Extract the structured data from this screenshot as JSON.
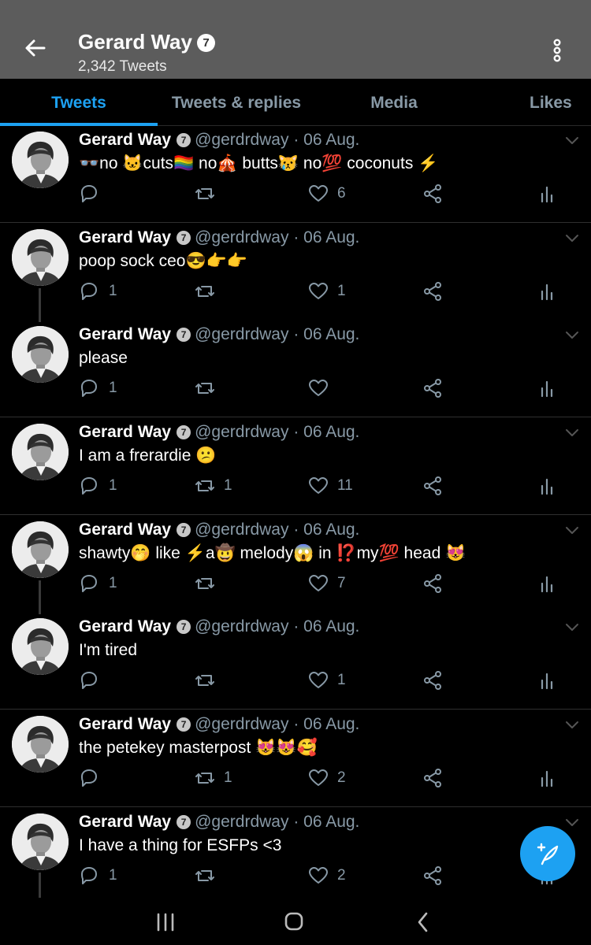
{
  "header": {
    "title": "Gerard Way",
    "verified_glyph": "7",
    "tweet_count": "2,342 Tweets",
    "back_icon": "arrow-left-icon",
    "more_icon": "more-vertical-icon"
  },
  "tabs": [
    {
      "label": "Tweets",
      "active": true
    },
    {
      "label": "Tweets & replies",
      "active": false
    },
    {
      "label": "Media",
      "active": false
    },
    {
      "label": "Likes",
      "active": false
    }
  ],
  "colors": {
    "accent": "#1da1f2",
    "header_bg": "#5c5c5c",
    "muted": "#8899a6",
    "background": "#000000"
  },
  "tweets": [
    {
      "name": "Gerard Way",
      "badge": "7",
      "handle": "@gerdrdway",
      "date": "· 06 Aug.",
      "segments": [
        "👓",
        "no ",
        "🐱",
        "cuts",
        "🏳️‍🌈",
        " no",
        "🎪",
        " butts",
        "😿",
        " no",
        "💯",
        " coconuts ",
        "⚡"
      ],
      "replies": "",
      "retweets": "",
      "likes": "6"
    },
    {
      "name": "Gerard Way",
      "badge": "7",
      "handle": "@gerdrdway",
      "date": "· 06 Aug.",
      "segments": [
        "poop sock ceo",
        "😎",
        "👉",
        "👉"
      ],
      "replies": "1",
      "retweets": "",
      "likes": "1"
    },
    {
      "name": "Gerard Way",
      "badge": "7",
      "handle": "@gerdrdway",
      "date": "· 06 Aug.",
      "segments": [
        "please"
      ],
      "replies": "1",
      "retweets": "",
      "likes": ""
    },
    {
      "name": "Gerard Way",
      "badge": "7",
      "handle": "@gerdrdway",
      "date": "· 06 Aug.",
      "segments": [
        "I am a frerardie ",
        "😕"
      ],
      "replies": "1",
      "retweets": "1",
      "likes": "11"
    },
    {
      "name": "Gerard Way",
      "badge": "7",
      "handle": "@gerdrdway",
      "date": "· 06 Aug.",
      "segments": [
        "shawty",
        "🤭",
        " like ",
        "⚡",
        "a",
        "🤠",
        " melody",
        "😱",
        " in ",
        "⁉️",
        "my",
        "💯",
        " head ",
        "😻"
      ],
      "replies": "1",
      "retweets": "",
      "likes": "7"
    },
    {
      "name": "Gerard Way",
      "badge": "7",
      "handle": "@gerdrdway",
      "date": "· 06 Aug.",
      "segments": [
        "I'm tired"
      ],
      "replies": "",
      "retweets": "",
      "likes": "1"
    },
    {
      "name": "Gerard Way",
      "badge": "7",
      "handle": "@gerdrdway",
      "date": "· 06 Aug.",
      "segments": [
        "the petekey masterpost ",
        "😻",
        "😻",
        "🥰"
      ],
      "replies": "",
      "retweets": "1",
      "likes": "2"
    },
    {
      "name": "Gerard Way",
      "badge": "7",
      "handle": "@gerdrdway",
      "date": "· 06 Aug.",
      "segments": [
        "I have a thing for ESFPs <3"
      ],
      "replies": "1",
      "retweets": "",
      "likes": "2"
    }
  ],
  "fab": {
    "icon": "compose-tweet-icon"
  },
  "navbar": {
    "icons": [
      "recent-apps-icon",
      "home-icon",
      "back-icon"
    ]
  }
}
